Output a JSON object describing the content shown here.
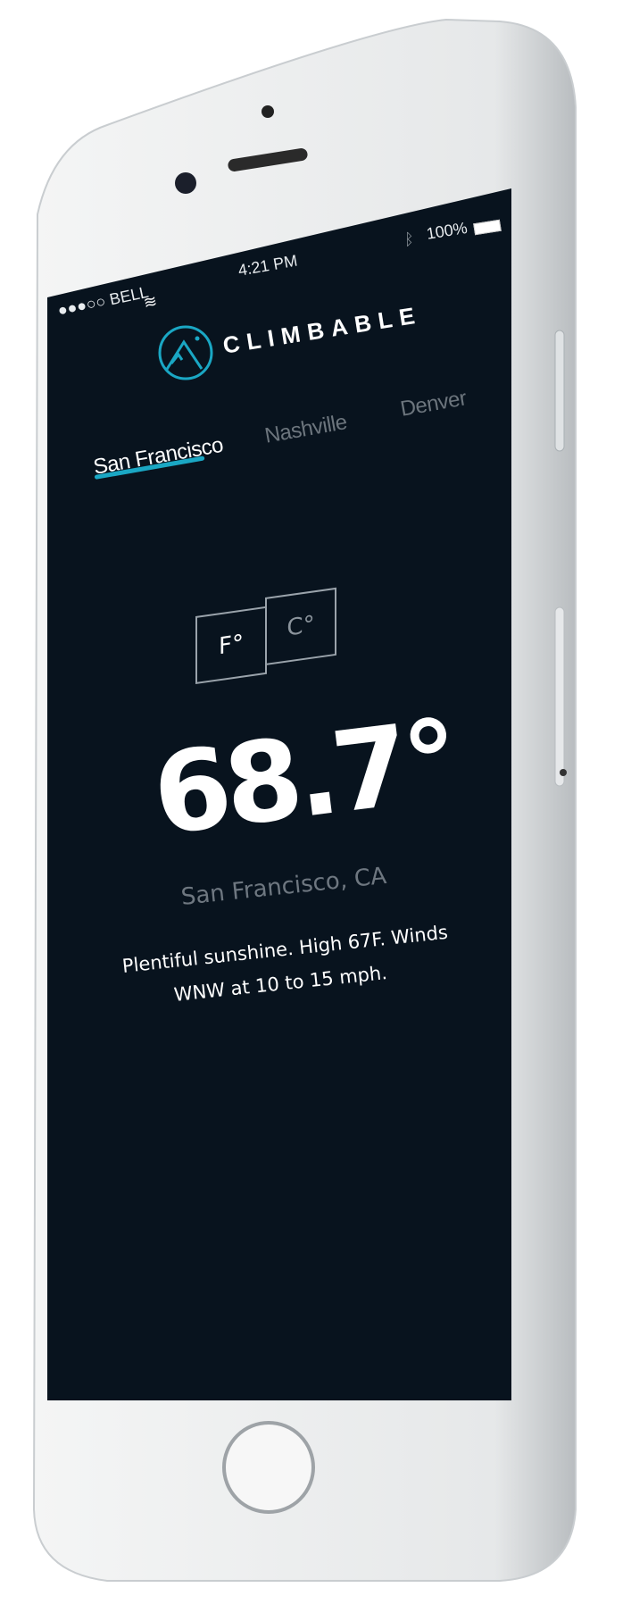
{
  "status_bar": {
    "carrier": "●●●○○ BELL",
    "time": "4:21 PM",
    "battery": "100%"
  },
  "app": {
    "name": "CLIMBABLE",
    "accent": "#1aa7c4"
  },
  "tabs": [
    {
      "label": "San Francisco",
      "active": true
    },
    {
      "label": "Nashville",
      "active": false
    },
    {
      "label": "Denver",
      "active": false
    }
  ],
  "units": {
    "fahrenheit": "F°",
    "celsius": "C°",
    "selected": "F°"
  },
  "weather": {
    "temperature": "68.7°",
    "location": "San Francisco, CA",
    "summary_line1": "Plentiful sunshine. High 67F. Winds",
    "summary_line2": "WNW at 10 to 15 mph."
  }
}
